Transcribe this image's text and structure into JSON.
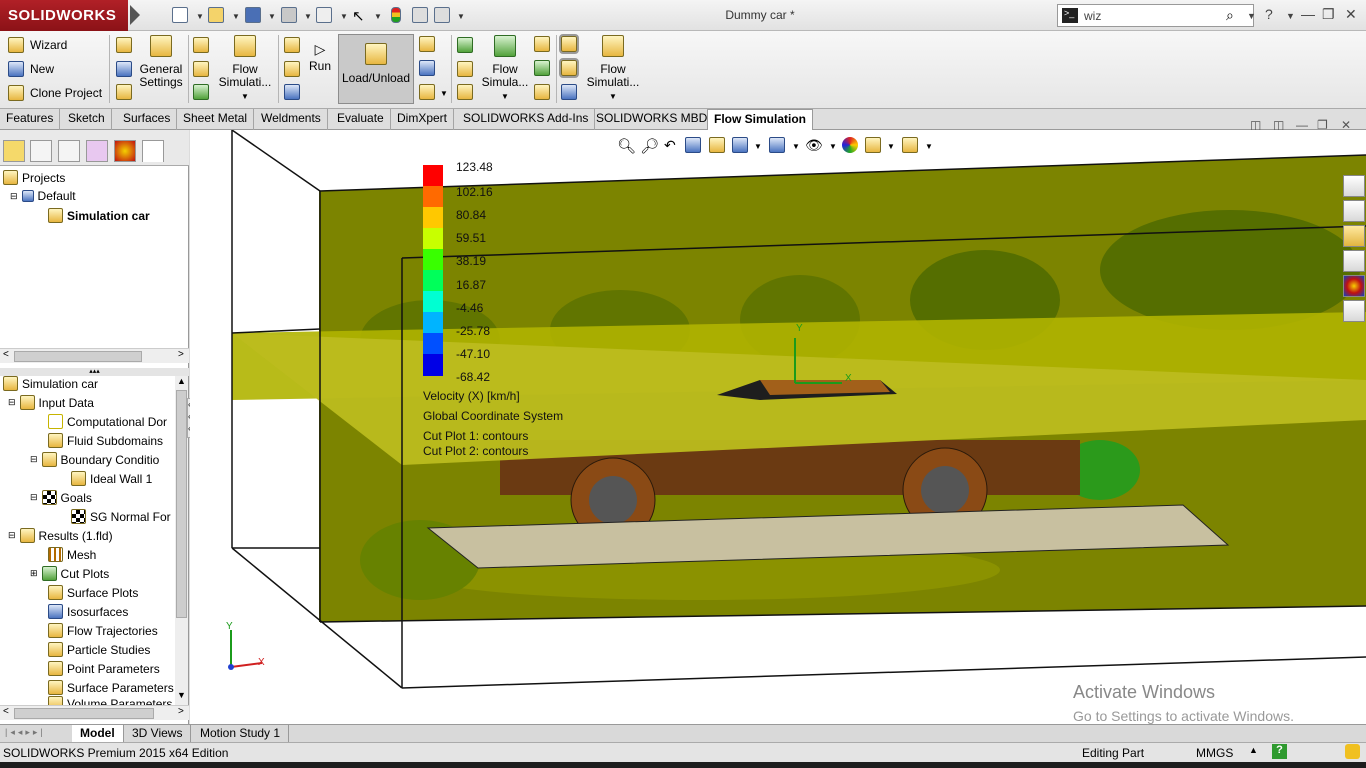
{
  "app": {
    "brand": "SOLIDWORKS",
    "document_title": "Dummy car *"
  },
  "search": {
    "value": "wiz"
  },
  "command_manager": {
    "left_items": [
      {
        "label": "Wizard",
        "icon": "wand-icon"
      },
      {
        "label": "New",
        "icon": "new-doc-icon"
      },
      {
        "label": "Clone Project",
        "icon": "clone-icon"
      }
    ],
    "general_settings": "General Settings",
    "flow_sim1": "Flow Simulati...",
    "run": "Run",
    "load_unload": "Load/Unload",
    "flow_sim2": "Flow Simula...",
    "flow_sim3": "Flow Simulati..."
  },
  "tabs": [
    {
      "label": "Features"
    },
    {
      "label": "Sketch"
    },
    {
      "label": "Surfaces"
    },
    {
      "label": "Sheet Metal"
    },
    {
      "label": "Weldments"
    },
    {
      "label": "Evaluate"
    },
    {
      "label": "DimXpert"
    },
    {
      "label": "SOLIDWORKS Add-Ins"
    },
    {
      "label": "SOLIDWORKS MBD"
    },
    {
      "label": "Flow Simulation"
    }
  ],
  "project_tree": {
    "root": "Projects",
    "config": "Default",
    "project": "Simulation car"
  },
  "analysis_tree": {
    "root": "Simulation car",
    "items": [
      {
        "label": "Input Data"
      },
      {
        "label": "Computational Dor"
      },
      {
        "label": "Fluid Subdomains"
      },
      {
        "label": "Boundary Conditio"
      },
      {
        "label": "Ideal Wall 1"
      },
      {
        "label": "Goals"
      },
      {
        "label": "SG Normal For"
      },
      {
        "label": "Results (1.fld)"
      },
      {
        "label": "Mesh"
      },
      {
        "label": "Cut Plots"
      },
      {
        "label": "Surface Plots"
      },
      {
        "label": "Isosurfaces"
      },
      {
        "label": "Flow Trajectories"
      },
      {
        "label": "Particle Studies"
      },
      {
        "label": "Point Parameters"
      },
      {
        "label": "Surface Parameters"
      },
      {
        "label": "Volume Parameters"
      }
    ]
  },
  "legend": {
    "values": [
      "123.48",
      "102.16",
      "80.84",
      "59.51",
      "38.19",
      "16.87",
      "-4.46",
      "-25.78",
      "-47.10",
      "-68.42"
    ],
    "colors": [
      "#ff0000",
      "#ff6a00",
      "#ffc800",
      "#c8ff00",
      "#39ff00",
      "#00ff5a",
      "#00ffd2",
      "#00b4ff",
      "#0050ff",
      "#0000e6"
    ],
    "quantity": "Velocity (X) [km/h]",
    "coordinate_system": "Global Coordinate System",
    "cut_plot_1": "Cut Plot 1: contours",
    "cut_plot_2": "Cut Plot 2: contours"
  },
  "triad": {
    "y": "Y",
    "x": "X"
  },
  "watermark": {
    "line1": "Activate Windows",
    "line2": "Go to Settings to activate Windows."
  },
  "bottom_tabs": [
    {
      "label": "Model"
    },
    {
      "label": "3D Views"
    },
    {
      "label": "Motion Study 1"
    }
  ],
  "status": {
    "edition": "SOLIDWORKS Premium 2015 x64 Edition",
    "mode": "Editing Part",
    "units": "MMGS"
  }
}
